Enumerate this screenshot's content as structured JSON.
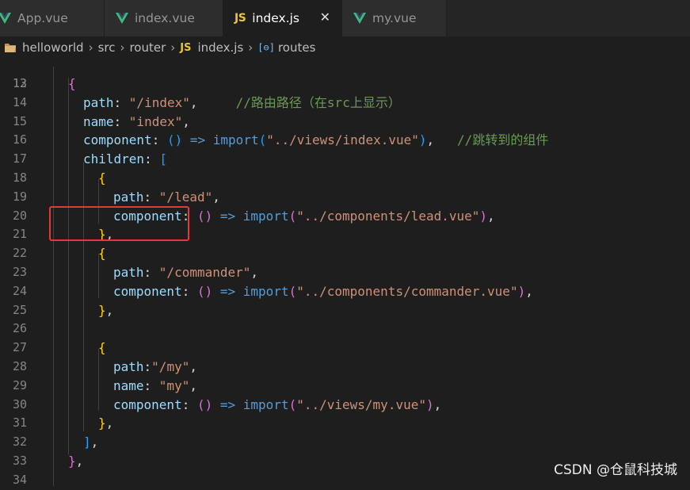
{
  "tabs": [
    {
      "label": "App.vue",
      "icon": "vue-icon",
      "active": false
    },
    {
      "label": "index.vue",
      "icon": "vue-icon",
      "active": false
    },
    {
      "label": "index.js",
      "icon": "js-icon",
      "active": true,
      "close": "✕"
    },
    {
      "label": "my.vue",
      "icon": "vue-icon",
      "active": false
    }
  ],
  "breadcrumb": {
    "items": [
      "helloworld",
      "src",
      "router",
      "index.js",
      "routes"
    ],
    "js_badge": "JS",
    "var_badge": "[⊖]"
  },
  "editor": {
    "first_line_partial": "12",
    "lines": [
      {
        "num": "13",
        "tokens": [
          [
            "b2",
            "{"
          ]
        ]
      },
      {
        "num": "14",
        "tokens": [
          [
            "k",
            "path"
          ],
          [
            "p",
            ": "
          ],
          [
            "s",
            "\"/index\""
          ],
          [
            "p",
            ",     "
          ],
          [
            "c",
            "//路由路径（在src上显示）"
          ]
        ]
      },
      {
        "num": "15",
        "tokens": [
          [
            "k",
            "name"
          ],
          [
            "p",
            ": "
          ],
          [
            "s",
            "\"index\""
          ],
          [
            "p",
            ","
          ]
        ]
      },
      {
        "num": "16",
        "tokens": [
          [
            "k",
            "component"
          ],
          [
            "p",
            ": "
          ],
          [
            "b3",
            "()"
          ],
          [
            "p",
            " "
          ],
          [
            "kw",
            "=>"
          ],
          [
            "p",
            " "
          ],
          [
            "f",
            "import"
          ],
          [
            "b3",
            "("
          ],
          [
            "s",
            "\"../views/index.vue\""
          ],
          [
            "b3",
            ")"
          ],
          [
            "p",
            ",   "
          ],
          [
            "c",
            "//跳转到的组件"
          ]
        ]
      },
      {
        "num": "17",
        "tokens": [
          [
            "k",
            "children"
          ],
          [
            "p",
            ": "
          ],
          [
            "b3",
            "["
          ]
        ]
      },
      {
        "num": "18",
        "tokens": [
          [
            "b1",
            "{"
          ]
        ]
      },
      {
        "num": "19",
        "tokens": [
          [
            "k",
            "path"
          ],
          [
            "p",
            ": "
          ],
          [
            "s",
            "\"/lead\""
          ],
          [
            "p",
            ","
          ]
        ]
      },
      {
        "num": "20",
        "tokens": [
          [
            "k",
            "component"
          ],
          [
            "p",
            ": "
          ],
          [
            "b2",
            "()"
          ],
          [
            "p",
            " "
          ],
          [
            "kw",
            "=>"
          ],
          [
            "p",
            " "
          ],
          [
            "f",
            "import"
          ],
          [
            "b2",
            "("
          ],
          [
            "s",
            "\"../components/lead.vue\""
          ],
          [
            "b2",
            ")"
          ],
          [
            "p",
            ","
          ]
        ]
      },
      {
        "num": "21",
        "tokens": [
          [
            "b1",
            "}"
          ],
          [
            "p",
            ","
          ]
        ]
      },
      {
        "num": "22",
        "tokens": [
          [
            "b1",
            "{"
          ]
        ]
      },
      {
        "num": "23",
        "tokens": [
          [
            "k",
            "path"
          ],
          [
            "p",
            ": "
          ],
          [
            "s",
            "\"/commander\""
          ],
          [
            "p",
            ","
          ]
        ]
      },
      {
        "num": "24",
        "tokens": [
          [
            "k",
            "component"
          ],
          [
            "p",
            ": "
          ],
          [
            "b2",
            "()"
          ],
          [
            "p",
            " "
          ],
          [
            "kw",
            "=>"
          ],
          [
            "p",
            " "
          ],
          [
            "f",
            "import"
          ],
          [
            "b2",
            "("
          ],
          [
            "s",
            "\"../components/commander.vue\""
          ],
          [
            "b2",
            ")"
          ],
          [
            "p",
            ","
          ]
        ]
      },
      {
        "num": "25",
        "tokens": [
          [
            "b1",
            "}"
          ],
          [
            "p",
            ","
          ]
        ]
      },
      {
        "num": "26",
        "tokens": []
      },
      {
        "num": "27",
        "tokens": [
          [
            "b1",
            "{"
          ]
        ]
      },
      {
        "num": "28",
        "tokens": [
          [
            "k",
            "path"
          ],
          [
            "p",
            ":"
          ],
          [
            "s",
            "\"/my\""
          ],
          [
            "p",
            ","
          ]
        ]
      },
      {
        "num": "29",
        "tokens": [
          [
            "k",
            "name"
          ],
          [
            "p",
            ": "
          ],
          [
            "s",
            "\"my\""
          ],
          [
            "p",
            ","
          ]
        ]
      },
      {
        "num": "30",
        "tokens": [
          [
            "k",
            "component"
          ],
          [
            "p",
            ": "
          ],
          [
            "b2",
            "()"
          ],
          [
            "p",
            " "
          ],
          [
            "kw",
            "=>"
          ],
          [
            "p",
            " "
          ],
          [
            "f",
            "import"
          ],
          [
            "b2",
            "("
          ],
          [
            "s",
            "\"../views/my.vue\""
          ],
          [
            "b2",
            ")"
          ],
          [
            "p",
            ","
          ]
        ]
      },
      {
        "num": "31",
        "tokens": [
          [
            "b1",
            "}"
          ],
          [
            "p",
            ","
          ]
        ]
      },
      {
        "num": "32",
        "tokens": [
          [
            "b3",
            "]"
          ],
          [
            "p",
            ","
          ]
        ]
      },
      {
        "num": "33",
        "tokens": [
          [
            "b2",
            "}"
          ],
          [
            "p",
            ","
          ]
        ]
      },
      {
        "num": "34",
        "tokens": []
      }
    ]
  },
  "watermark": "CSDN @仓鼠科技城",
  "colors": {
    "background": "#1e1e1e",
    "highlight_box": "#e53935",
    "vue_green": "#41b883",
    "js_yellow": "#e8c534"
  }
}
